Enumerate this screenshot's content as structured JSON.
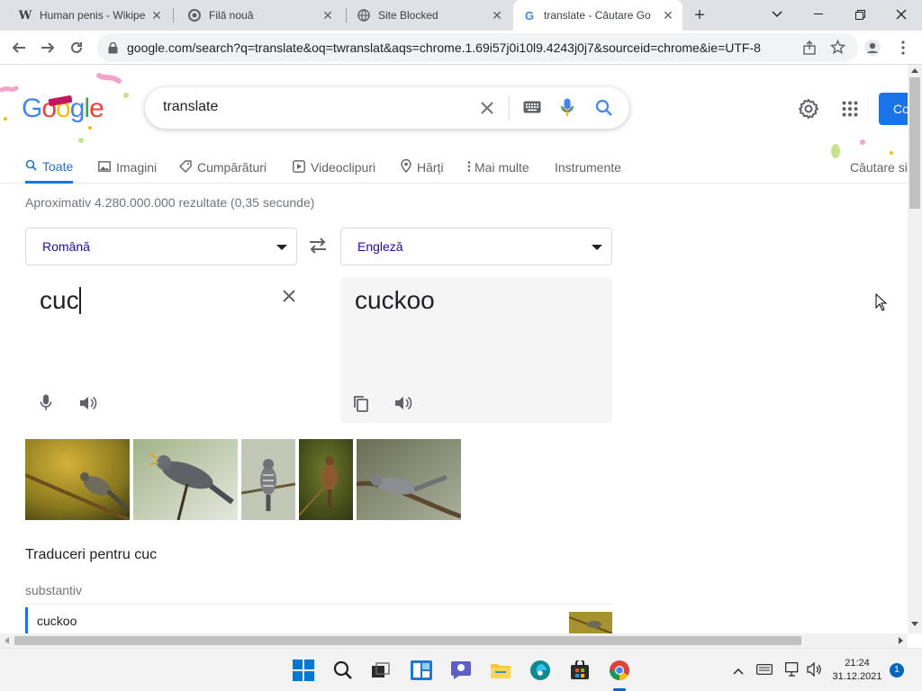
{
  "browser": {
    "tabs": [
      {
        "title": "Human penis - Wikipe",
        "favicon": "wikipedia-icon",
        "active": false
      },
      {
        "title": "Filă nouă",
        "favicon": "chrome-icon",
        "active": false
      },
      {
        "title": "Site Blocked",
        "favicon": "globe-icon",
        "active": false
      },
      {
        "title": "translate - Căutare Go",
        "favicon": "google-icon",
        "active": true
      }
    ],
    "new_tab": "+",
    "url": "google.com/search?q=translate&oq=twranslat&aqs=chrome.1.69i57j0i10l9.4243j0j7&sourceid=chrome&ie=UTF-8"
  },
  "google": {
    "logo_text": "Google",
    "query": "translate",
    "signin_label": "Co",
    "tabs": [
      {
        "label": "Toate",
        "icon": "search-icon",
        "active": true
      },
      {
        "label": "Imagini",
        "icon": "image-icon"
      },
      {
        "label": "Cumpărături",
        "icon": "tag-icon"
      },
      {
        "label": "Videoclipuri",
        "icon": "play-icon"
      },
      {
        "label": "Hărți",
        "icon": "map-pin-icon"
      },
      {
        "label": "Mai multe",
        "icon": "more-vert-icon"
      },
      {
        "label": "Instrumente",
        "icon": ""
      }
    ],
    "safe_search_label": "Căutare si",
    "result_stats": "Aproximativ 4.280.000.000 rezultate (0,35 secunde)"
  },
  "translate": {
    "source_lang": "Română",
    "target_lang": "Engleză",
    "source_text": "cuc",
    "target_text": "cuckoo",
    "translations_heading": "Traduceri pentru cuc",
    "pos": "substantiv",
    "translation_row": "cuckoo"
  },
  "taskbar": {
    "time": "21:24",
    "date": "31.12.2021",
    "notification_count": "1"
  },
  "colors": {
    "accent": "#1a73e8",
    "tabbar": "#dee1e6",
    "signin_bg": "#1a73e8"
  }
}
